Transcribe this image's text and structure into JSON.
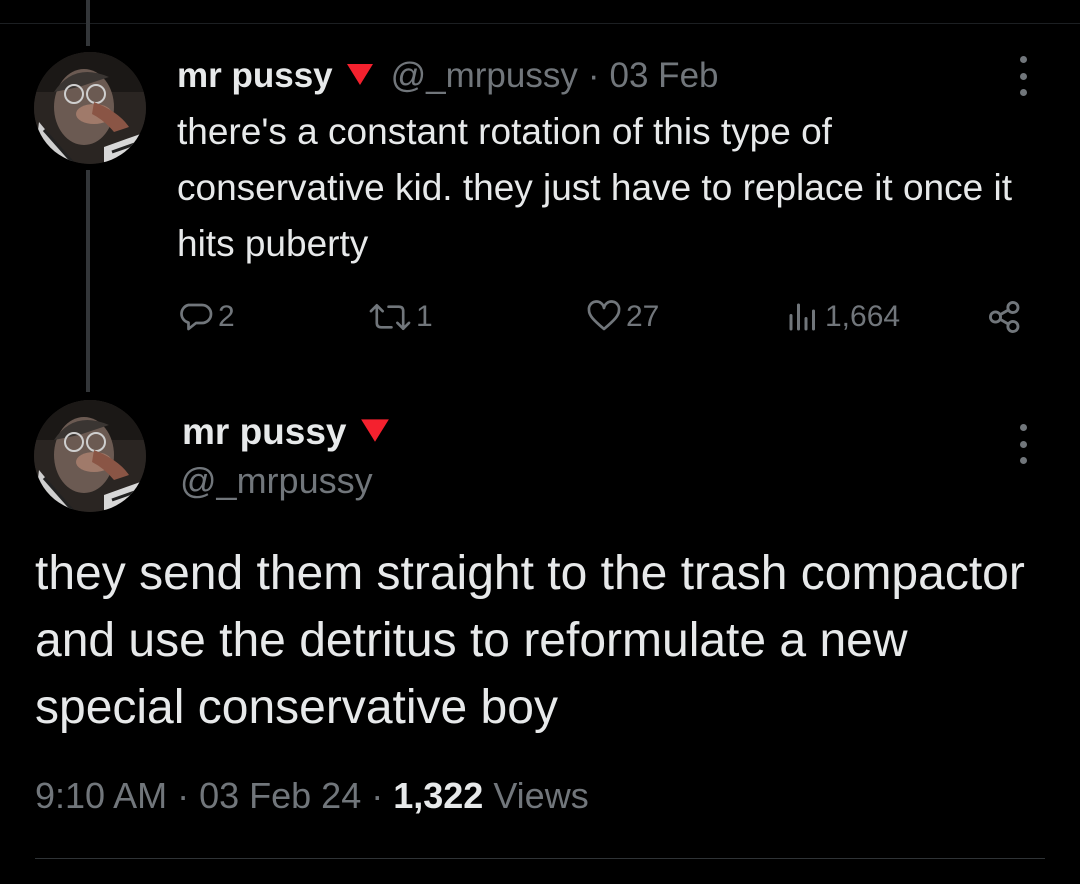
{
  "accent_colors": {
    "badge_red": "#f4212e",
    "muted": "#71767b",
    "text": "#e7e9ea",
    "background": "#000000"
  },
  "reply_tweet": {
    "display_name": "mr pussy",
    "badge_icon": "red-triangle-icon",
    "handle": "@_mrpussy",
    "separator": "·",
    "date": "03 Feb",
    "text": "there's a constant rotation of this type of conservative kid. they just have to replace it once it hits puberty",
    "actions": {
      "replies": "2",
      "retweets": "1",
      "likes": "27",
      "views": "1,664"
    }
  },
  "main_tweet": {
    "display_name": "mr pussy",
    "badge_icon": "red-triangle-icon",
    "handle": "@_mrpussy",
    "text": "they send them straight to the trash compactor and use the detritus to reformulate a new special conservative boy",
    "time": "9:10 AM",
    "sep1": " · ",
    "date": "03 Feb 24",
    "sep2": " · ",
    "views_count": "1,322",
    "views_label": " Views"
  }
}
